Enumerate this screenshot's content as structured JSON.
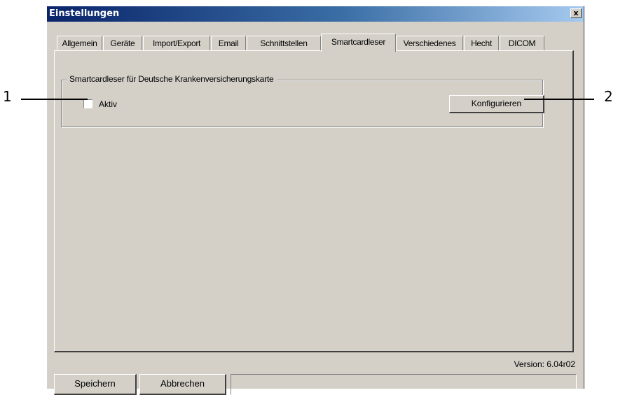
{
  "window": {
    "title": "Einstellungen",
    "close_label": "x"
  },
  "tabs": [
    {
      "label": "Allgemein",
      "selected": false
    },
    {
      "label": "Geräte",
      "selected": false
    },
    {
      "label": "Import/Export",
      "selected": false
    },
    {
      "label": "Email",
      "selected": false
    },
    {
      "label": "Schnittstellen",
      "selected": false
    },
    {
      "label": "Smartcardleser",
      "selected": true
    },
    {
      "label": "Verschiedenes",
      "selected": false
    },
    {
      "label": "Hecht",
      "selected": false
    },
    {
      "label": "DICOM",
      "selected": false
    }
  ],
  "group": {
    "title": "Smartcardleser für Deutsche Krankenversicherungskarte",
    "checkbox_label": "Aktiv",
    "checkbox_checked": false,
    "configure_label": "Konfigurieren"
  },
  "version": "Version: 6.04r02",
  "footer": {
    "save_label": "Speichern",
    "cancel_label": "Abbrechen"
  },
  "callouts": [
    "1",
    "2"
  ]
}
